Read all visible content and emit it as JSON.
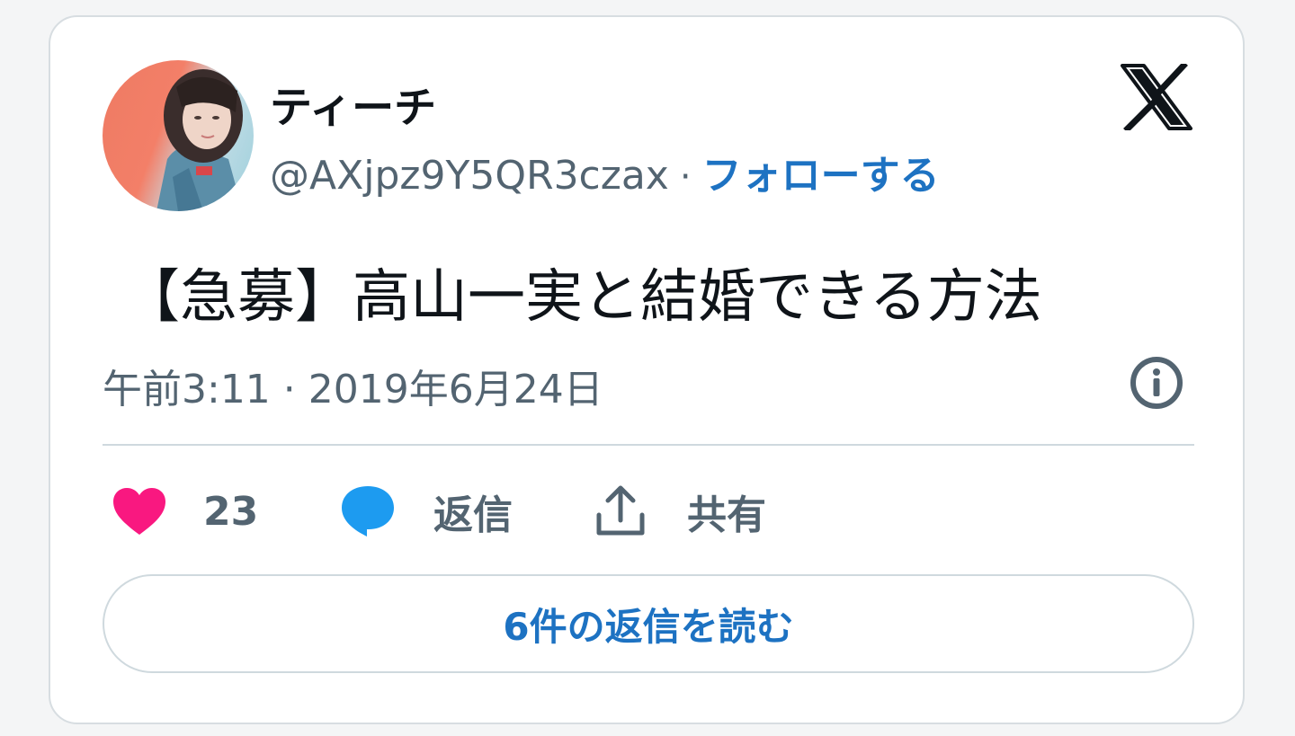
{
  "user": {
    "display_name": "ティーチ",
    "handle": "@AXjpz9Y5QR3czax",
    "separator": "·",
    "follow_label": "フォローする"
  },
  "tweet": {
    "text": "【急募】高山一実と結婚できる方法",
    "timestamp": "午前3:11 · 2019年6月24日"
  },
  "actions": {
    "like_count": "23",
    "reply_label": "返信",
    "share_label": "共有"
  },
  "read_replies_label": "6件の返信を読む",
  "icons": {
    "brand": "x-logo-icon",
    "info": "info-icon",
    "like": "heart-icon",
    "reply": "speech-bubble-icon",
    "share": "share-icon"
  },
  "colors": {
    "link": "#1d72c2",
    "like": "#f91880",
    "reply": "#1d9bf0",
    "muted": "#536471",
    "text": "#0f1419"
  }
}
